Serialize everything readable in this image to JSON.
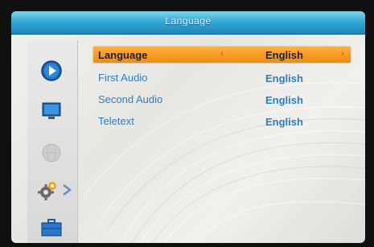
{
  "window": {
    "title": "Language"
  },
  "sidebar": {
    "items": [
      {
        "icon": "play-icon",
        "selected": false
      },
      {
        "icon": "monitor-icon",
        "selected": false
      },
      {
        "icon": "globe-icon",
        "selected": false
      },
      {
        "icon": "gear-icon",
        "selected": true
      },
      {
        "icon": "toolbox-icon",
        "selected": false
      }
    ]
  },
  "menu": {
    "rows": [
      {
        "label": "Language",
        "value": "English",
        "selected": true,
        "left_arrow": "‹",
        "right_arrow": "›"
      },
      {
        "label": "First Audio",
        "value": "English",
        "selected": false
      },
      {
        "label": "Second Audio",
        "value": "English",
        "selected": false
      },
      {
        "label": "Teletext",
        "value": "English",
        "selected": false
      }
    ]
  },
  "colors": {
    "title_bar": "#36a9d6",
    "selection": "#f08a12",
    "menu_text": "#2c7fbf"
  }
}
